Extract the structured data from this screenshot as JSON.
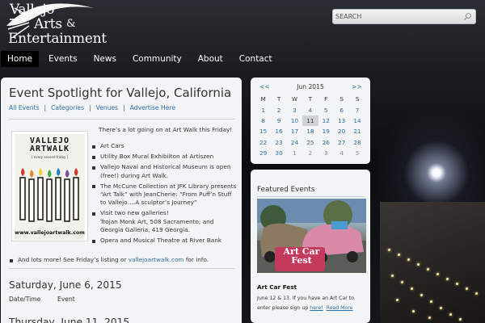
{
  "logo": {
    "word1": "Vallejo",
    "word2": "Arts",
    "ampersand": "&",
    "word3": "Entertainment"
  },
  "search": {
    "placeholder": "SEARCH"
  },
  "nav": {
    "items": [
      {
        "label": "Home",
        "active": true
      },
      {
        "label": "Events"
      },
      {
        "label": "News"
      },
      {
        "label": "Community"
      },
      {
        "label": "About"
      },
      {
        "label": "Contact"
      }
    ]
  },
  "main": {
    "title": "Event Spotlight for Vallejo, California",
    "sublinks": [
      "All Events",
      "Categories",
      "Venues",
      "Advertise Here"
    ],
    "intro": "There’s a lot going on at Art Walk this Friday!",
    "poster": {
      "title_line1": "VALLEJO",
      "title_line2": "ARTWALK",
      "subtitle": "[ every second friday ]",
      "url": "www.vallejoartwalk.com"
    },
    "bullets": [
      "Art Cars",
      "Utility Box Mural Exhibiiton at Artiszen",
      "Vallejo Naval and Historical Museum is open (free!) during Art Walk.",
      "The McCune Collection at JFK Library  presents “Art Talk” with JeanCherie: “From Puff’n Stuff to Vallejo….A sculptor’s Journey”",
      "Visit two new galleries!\nTrojan Monk Art, 508 Sacramento; and Georgia Galleria, 419 Georgia.",
      "Opera and Musical Theatre at River Bank"
    ],
    "more_text": "And lots more! See Friday’s listing or ",
    "more_link": "vallejoartwalk.com",
    "more_tail": " for info.",
    "date1": "Saturday, June 6, 2015",
    "col_datetime": "Date/Time",
    "col_event": "Event",
    "date2": "Thursday, June 11, 2015"
  },
  "calendar": {
    "prev": "<<",
    "next": ">>",
    "month": "Jun 2015",
    "weekdays": [
      "M",
      "T",
      "W",
      "T",
      "F",
      "S",
      "S"
    ],
    "weeks": [
      [
        "1",
        "2",
        "3",
        "4",
        "5",
        "6",
        "7"
      ],
      [
        "8",
        "9",
        "10",
        "11",
        "12",
        "13",
        "14"
      ],
      [
        "15",
        "16",
        "17",
        "18",
        "19",
        "20",
        "21"
      ],
      [
        "22",
        "23",
        "24",
        "25",
        "26",
        "27",
        "28"
      ],
      [
        "29",
        "30",
        "1",
        "2",
        "3",
        "4",
        "5"
      ]
    ],
    "today": "11"
  },
  "featured": {
    "heading": "Featured Events",
    "image_caption_1": "Art Car",
    "image_caption_2": "Fest",
    "event_title": "Art Car Fest",
    "description": "June 12 & 13. If you have an Art Car to enter please sign up ",
    "here_link": "here!",
    "read_more": "Read More"
  },
  "colors": {
    "link": "#2d6ea0",
    "panel": "#f3f4f5",
    "nav_active": "#000000",
    "poster_flames": [
      "#d43a2e",
      "#e88a2a",
      "#f2d23a",
      "#3fae49",
      "#2f7fc1",
      "#7a4aa0",
      "#d43a2e"
    ]
  }
}
